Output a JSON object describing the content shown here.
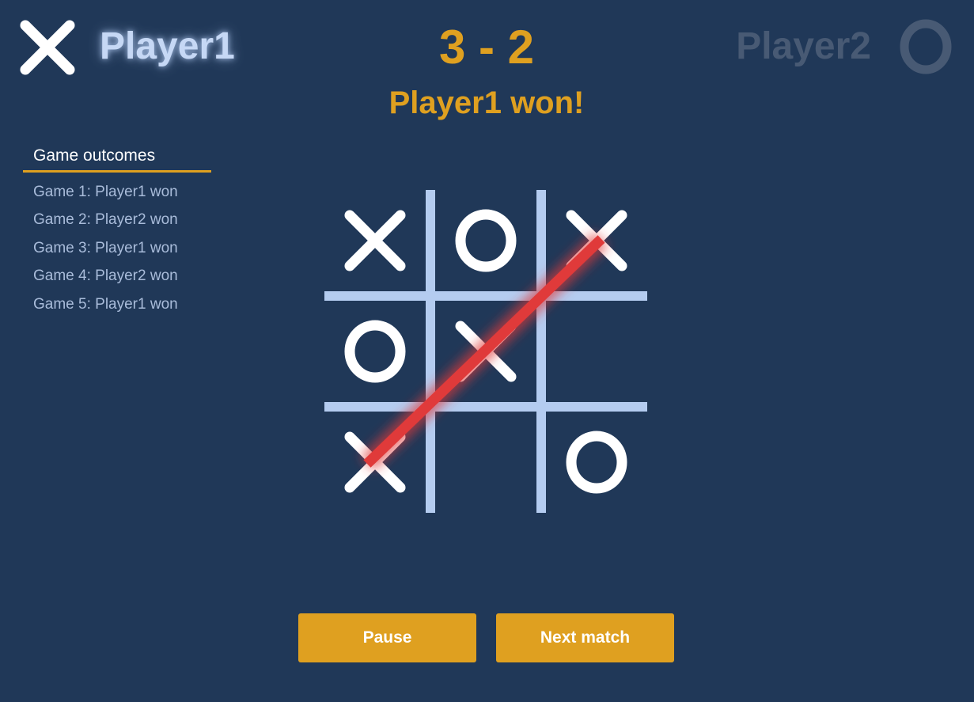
{
  "header": {
    "player1": {
      "name": "Player1",
      "mark": "X",
      "icon": "x-mark-icon",
      "active": true
    },
    "player2": {
      "name": "Player2",
      "mark": "O",
      "icon": "o-mark-icon",
      "active": false
    },
    "score": "3 - 2",
    "result": "Player1 won!"
  },
  "outcomes": {
    "title": "Game outcomes",
    "items": [
      "Game 1: Player1 won",
      "Game 2: Player2 won",
      "Game 3: Player1 won",
      "Game 4: Player2 won",
      "Game 5: Player1 won"
    ]
  },
  "board": {
    "cells": [
      [
        "X",
        "O",
        "X"
      ],
      [
        "O",
        "X",
        ""
      ],
      [
        "X",
        "",
        "O"
      ]
    ],
    "winning_line": [
      [
        2,
        0
      ],
      [
        0,
        2
      ]
    ]
  },
  "buttons": {
    "pause": "Pause",
    "next": "Next match"
  },
  "colors": {
    "background": "#203858",
    "accent": "#dfa020",
    "grid": "#b4ccf0",
    "win_line": "#e03a3a",
    "mark": "#ffffff",
    "inactive_player": "#485a74"
  }
}
